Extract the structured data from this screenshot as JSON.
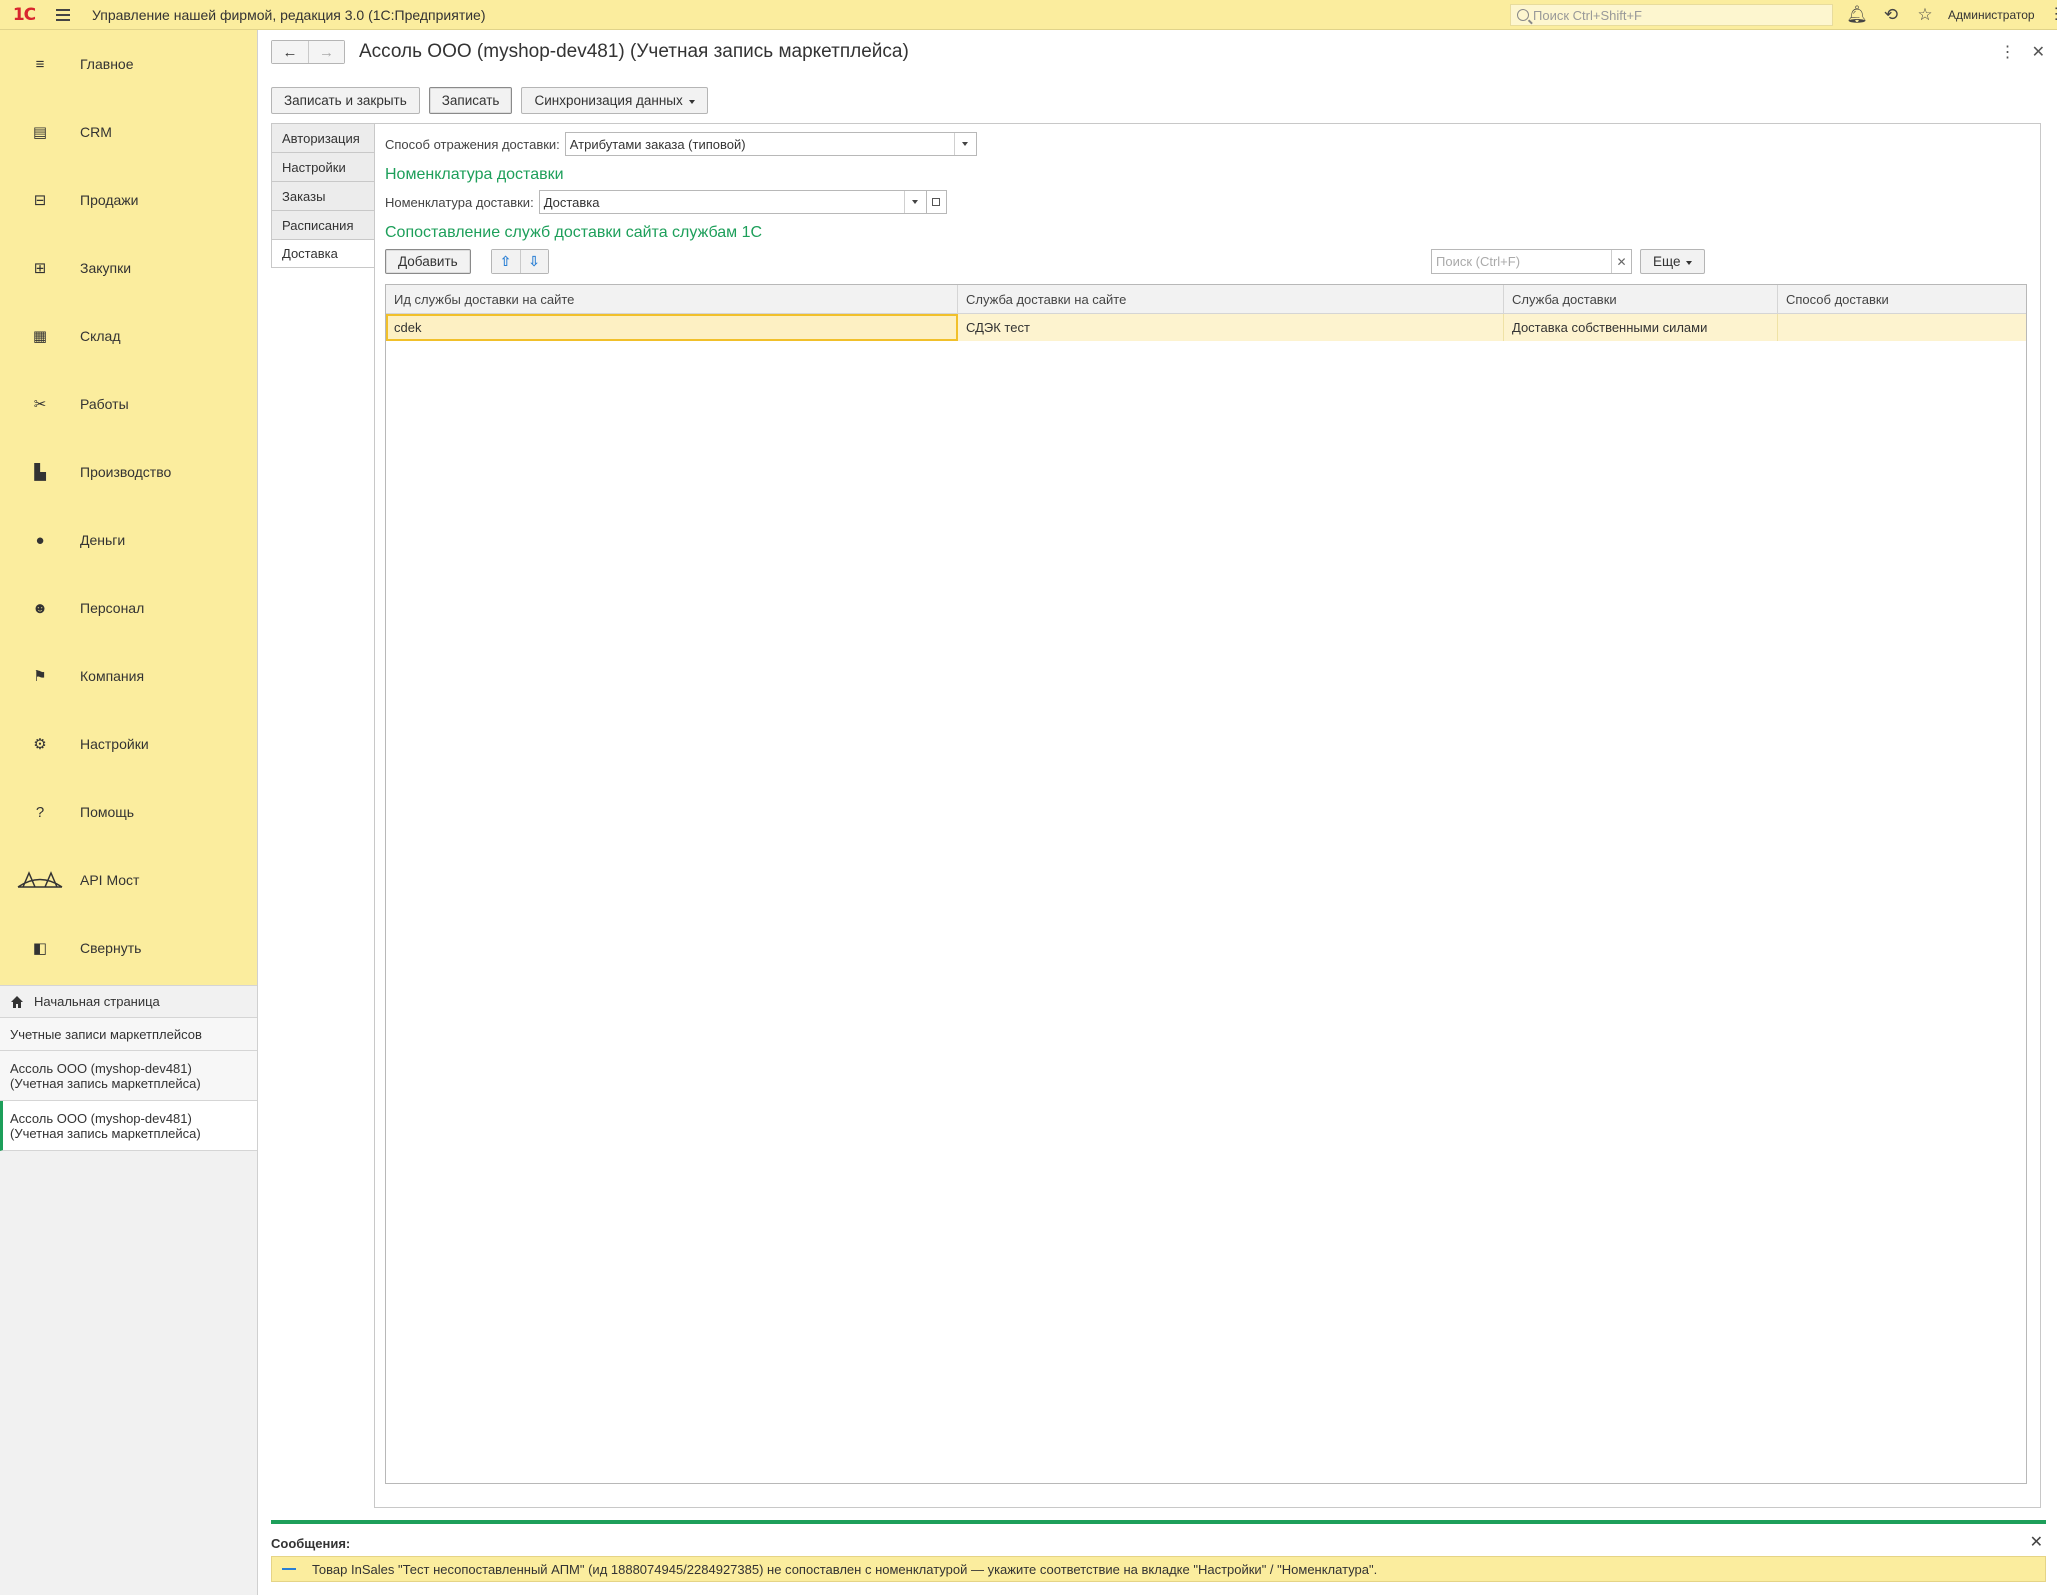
{
  "topbar": {
    "app_title": "Управление нашей фирмой, редакция 3.0  (1С:Предприятие)",
    "search_placeholder": "Поиск Ctrl+Shift+F",
    "user": "Администратор"
  },
  "sidebar": {
    "items": [
      {
        "label": "Главное",
        "icon": "menu-icon"
      },
      {
        "label": "CRM",
        "icon": "crm-icon"
      },
      {
        "label": "Продажи",
        "icon": "cart-icon"
      },
      {
        "label": "Закупки",
        "icon": "purchase-icon"
      },
      {
        "label": "Склад",
        "icon": "warehouse-icon"
      },
      {
        "label": "Работы",
        "icon": "tools-icon"
      },
      {
        "label": "Производство",
        "icon": "factory-icon"
      },
      {
        "label": "Деньги",
        "icon": "money-icon"
      },
      {
        "label": "Персонал",
        "icon": "people-icon"
      },
      {
        "label": "Компания",
        "icon": "flag-icon"
      },
      {
        "label": "Настройки",
        "icon": "gear-icon"
      },
      {
        "label": "Помощь",
        "icon": "help-icon"
      },
      {
        "label": "API Мост",
        "icon": "bridge-icon"
      },
      {
        "label": "Свернуть",
        "icon": "collapse-icon"
      }
    ],
    "open_windows": {
      "home": "Начальная страница",
      "accounts": "Учетные записи маркетплейсов",
      "doc1_line1": "Ассоль ООО (myshop-dev481)",
      "doc1_line2": "(Учетная запись маркетплейса)",
      "doc2_line1": "Ассоль ООО (myshop-dev481)",
      "doc2_line2": "(Учетная запись маркетплейса)"
    }
  },
  "form": {
    "title": "Ассоль ООО (myshop-dev481) (Учетная запись маркетплейса)",
    "buttons": {
      "save_close": "Записать и закрыть",
      "save": "Записать",
      "sync": "Синхронизация данных"
    },
    "tabs": [
      "Авторизация",
      "Настройки",
      "Заказы",
      "Расписания",
      "Доставка"
    ],
    "active_tab": 4,
    "delivery": {
      "method_label": "Способ отражения доставки:",
      "method_value": "Атрибутами заказа (типовой)",
      "nomenclature_group": "Номенклатура доставки",
      "nomenclature_label": "Номенклатура доставки:",
      "nomenclature_value": "Доставка",
      "mapping_group": "Сопоставление служб доставки сайта службам 1С",
      "add_button": "Добавить",
      "search_placeholder": "Поиск (Ctrl+F)",
      "more_button": "Еще",
      "columns": [
        "Ид службы доставки на сайте",
        "Служба доставки на сайте",
        "Служба доставки",
        "Способ доставки"
      ],
      "rows": [
        [
          "cdek",
          "СДЭК тест",
          "Доставка собственными силами",
          ""
        ]
      ]
    }
  },
  "messages": {
    "title": "Сообщения:",
    "text": "Товар InSales \"Тест несопоставленный АПМ\" (ид 1888074945/2284927385) не сопоставлен с номенклатурой — укажите соответствие на вкладке \"Настройки\" / \"Номенклатура\"."
  }
}
